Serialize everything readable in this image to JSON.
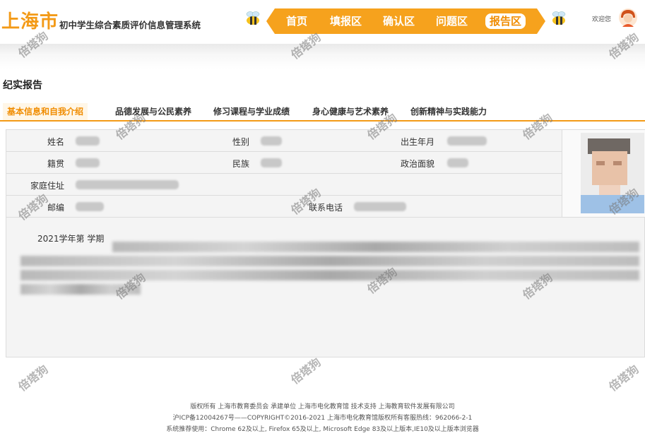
{
  "header": {
    "city": "上海市",
    "system_name": "初中学生综合素质评价信息管理系统",
    "welcome": "欢迎您"
  },
  "nav": {
    "items": [
      "首页",
      "填报区",
      "确认区",
      "问题区",
      "报告区"
    ],
    "active": "报告区"
  },
  "page": {
    "title": "纪实报告"
  },
  "tabs": {
    "items": [
      "基本信息和自我介绍",
      "品德发展与公民素养",
      "修习课程与学业成绩",
      "身心健康与艺术素养",
      "创新精神与实践能力"
    ],
    "active": 0
  },
  "info": {
    "name_label": "姓名",
    "gender_label": "性别",
    "birth_label": "出生年月",
    "native_label": "籍贯",
    "ethnic_label": "民族",
    "political_label": "政治面貌",
    "address_label": "家庭住址",
    "zip_label": "邮编",
    "phone_label": "联系电话"
  },
  "self_intro": {
    "term": "2021学年第 学期"
  },
  "footer": {
    "line1": "版权所有 上海市教育委员会    承建单位 上海市电化教育馆    技术支持 上海教育软件发展有限公司",
    "line2": "沪ICP备12004267号——COPYRIGHT©2016-2021 上海市电化教育馆版权所有客服热线：962066-2-1",
    "line3": "系统推荐使用：Chrome 62及以上, Firefox 65及以上, Microsoft Edge 83及以上版本,IE10及以上版本浏览器"
  },
  "watermark": "倍塔狗",
  "colors": {
    "accent": "#f39a17",
    "nav_bg": "#f6a21d",
    "panel_bg": "#f4f4f4"
  }
}
